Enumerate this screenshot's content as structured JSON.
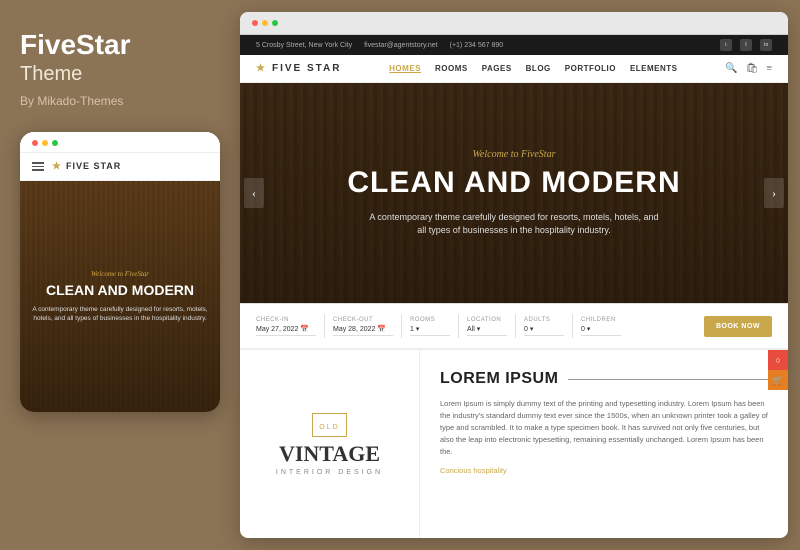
{
  "left": {
    "brand": "FiveStar",
    "theme_label": "Theme",
    "author": "By Mikado-Themes",
    "dots": [
      "r",
      "y",
      "g"
    ],
    "mobile": {
      "logo": "FIVE STAR",
      "welcome": "Welcome to FiveStar",
      "headline": "CLEAN AND MODERN",
      "subtext": "A contemporary theme carefully designed for resorts, motels, hotels, and all types of businesses in the hospitality industry."
    }
  },
  "browser": {
    "dots": [
      "r",
      "y",
      "g"
    ]
  },
  "site_info_bar": {
    "address": "5 Crosby Street, New York City",
    "email": "fivestar@agentstory.net",
    "phone": "(+1) 234 567 890"
  },
  "main_nav": {
    "logo": "FIVE STAR",
    "links": [
      "HOMES",
      "ROOMS",
      "PAGES",
      "BLOG",
      "PORTFOLIO",
      "ELEMENTS"
    ],
    "active": "HOMES"
  },
  "hero": {
    "welcome": "Welcome to FiveStar",
    "headline": "CLEAN AND MODERN",
    "subtext": "A contemporary theme carefully designed for resorts, motels, hotels,\nand all types of businesses in the hospitality industry."
  },
  "booking": {
    "fields": [
      {
        "label": "CHECK-IN",
        "value": "May 27, 2022"
      },
      {
        "label": "CHECK-OUT",
        "value": "May 28, 2022"
      },
      {
        "label": "ROOMS",
        "value": "1"
      },
      {
        "label": "LOCATION",
        "value": "All"
      },
      {
        "label": "ADULTS",
        "value": "0"
      },
      {
        "label": "CHILDREN",
        "value": "0"
      }
    ],
    "button": "BOOK NOW"
  },
  "content": {
    "vintage": {
      "tag": "OLD",
      "brand": "VINTAGE",
      "sub": "INTERIOR DESIGN"
    },
    "heading": "LOREM IPSUM",
    "body": "Lorem Ipsum is simply dummy text of the printing and typesetting industry. Lorem Ipsum has been the industry's standard dummy text ever since the 1500s, when an unknown printer took a galley of type and scrambled. It to make a type specimen book. It has survived not only five centuries, but also the leap into electronic typesetting, remaining essentially unchanged. Lorem Ipsum has been the.",
    "link": "Concious hospitality"
  }
}
